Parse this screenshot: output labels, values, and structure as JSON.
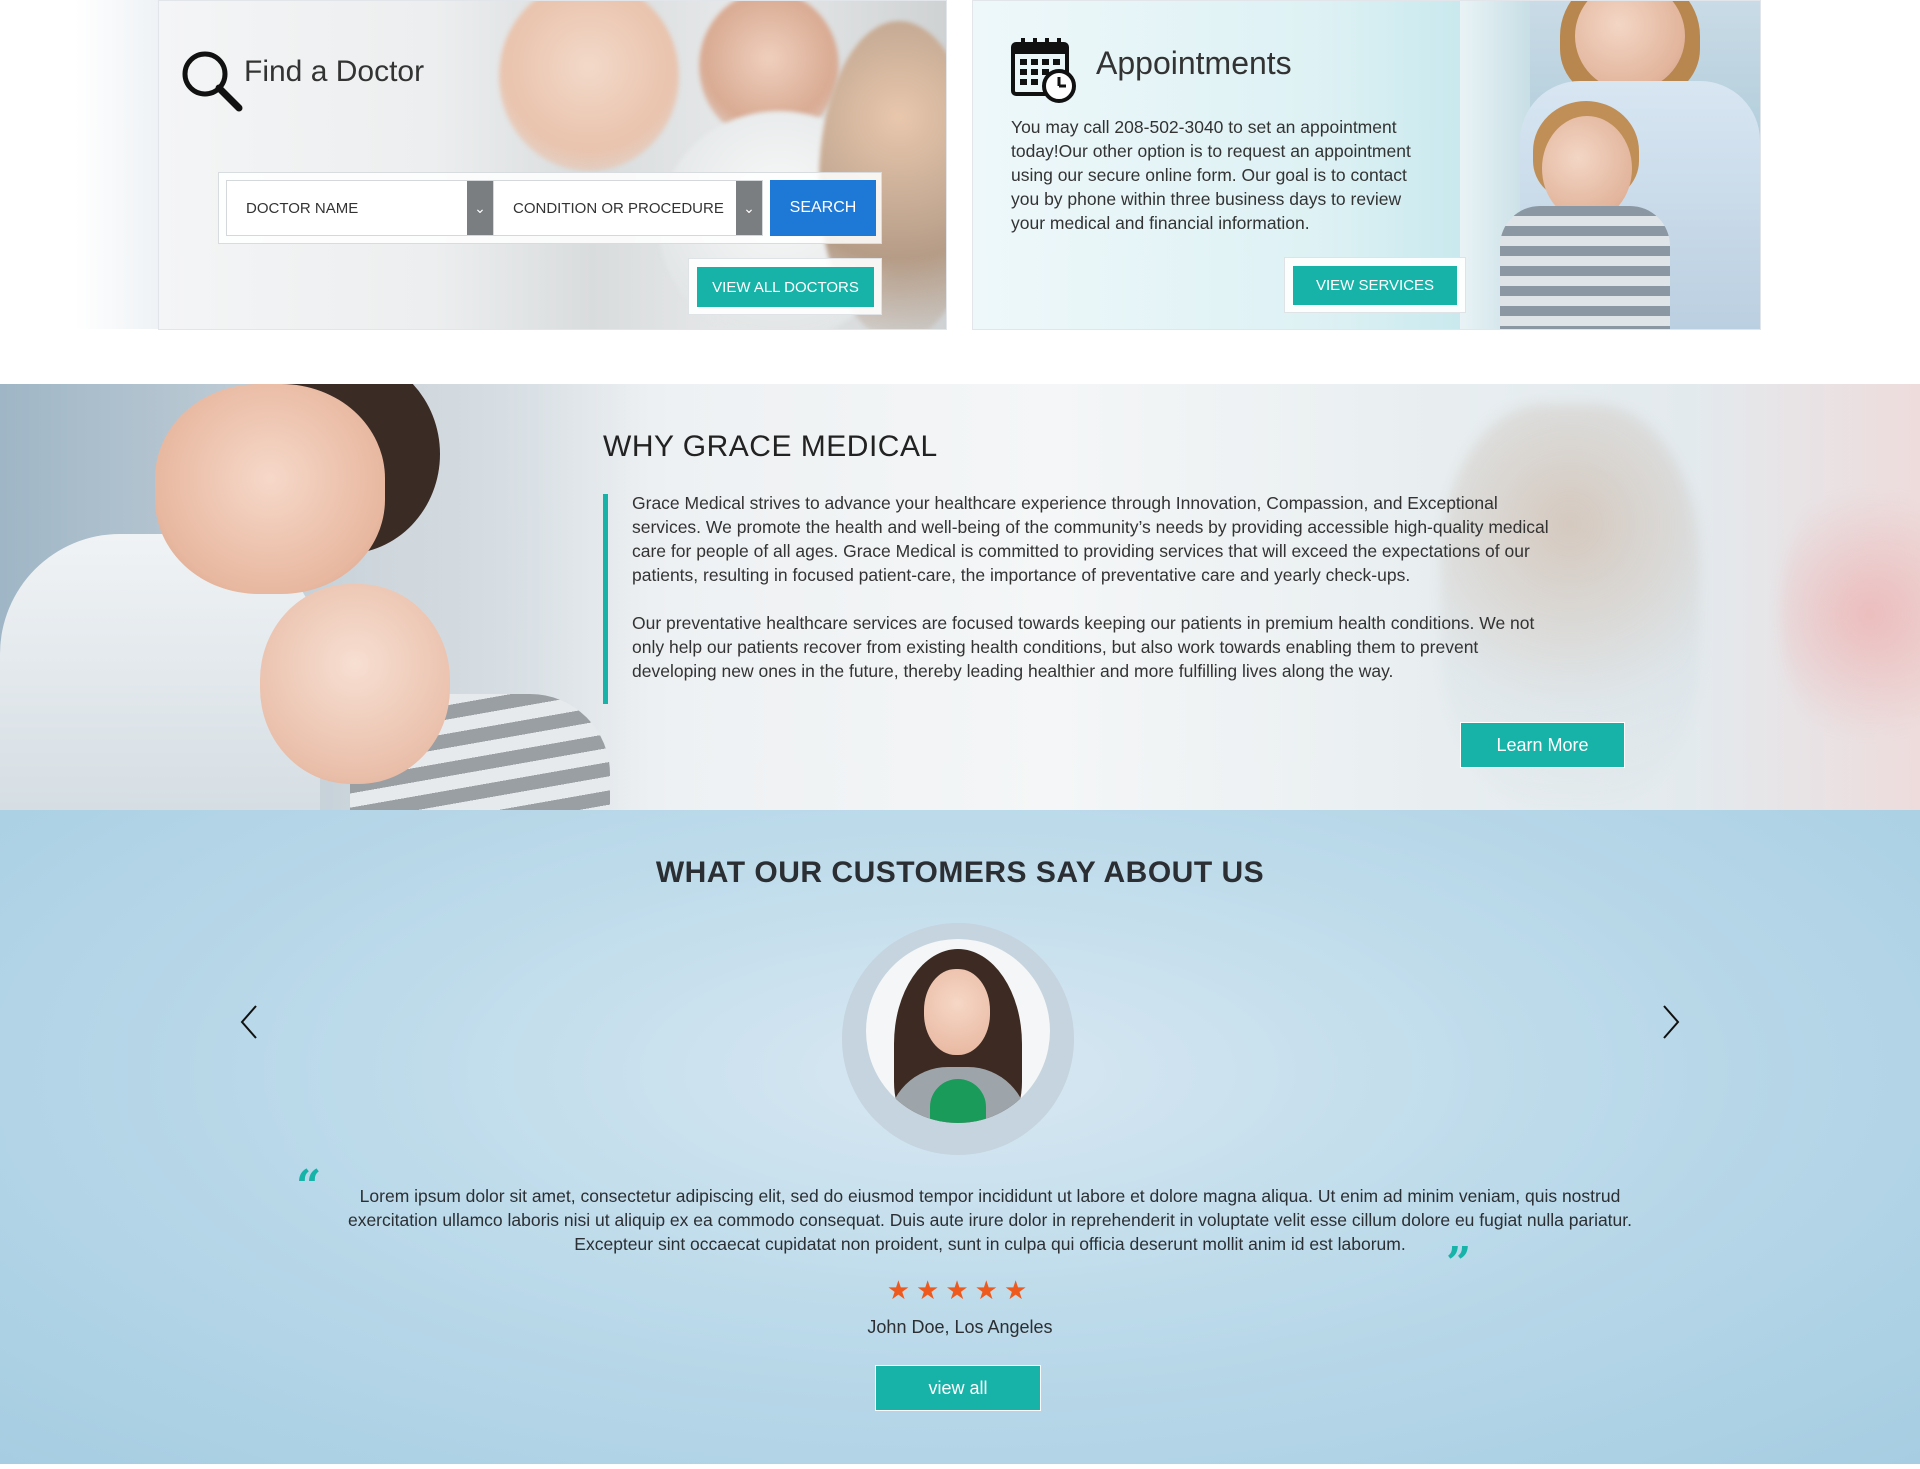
{
  "find_doctor": {
    "title": "Find a Doctor",
    "doctor_select": "DOCTOR NAME",
    "condition_select": "CONDITION OR PROCEDURE",
    "search_label": "SEARCH",
    "view_all_label": "VIEW ALL DOCTORS"
  },
  "appointments": {
    "title": "Appointments",
    "body": "You may call 208-502-3040 to set an appointment today!Our other option is to request an appointment using our secure online form. Our goal is to contact you by phone within three business days to review your medical and financial information.",
    "button_label": "VIEW SERVICES"
  },
  "why": {
    "title": "WHY GRACE MEDICAL",
    "paragraphs": [
      "Grace Medical strives to advance your healthcare experience through Innovation, Compassion, and Exceptional services. We promote the health and well-being of the community’s needs by providing accessible high-quality medical care for people of all ages. Grace Medical is committed to providing services that will exceed the expectations of our patients, resulting in focused patient-care, the importance of preventative care and yearly check-ups.",
      "Our preventative healthcare services are focused towards keeping our patients in premium health conditions. We not only help our patients recover from existing health conditions, but also work towards enabling them to prevent developing new ones in the future, thereby leading healthier and more fulfilling lives along the way."
    ],
    "button_label": "Learn More"
  },
  "testimonials": {
    "title": "WHAT OUR CUSTOMERS SAY ABOUT US",
    "quote": "Lorem ipsum dolor sit amet, consectetur adipiscing elit, sed do eiusmod tempor incididunt ut labore et dolore magna aliqua. Ut enim ad minim veniam, quis nostrud exercitation ullamco laboris nisi ut aliquip ex ea commodo consequat. Duis aute irure dolor in reprehenderit in voluptate velit esse cillum dolore eu fugiat nulla pariatur. Excepteur sint occaecat cupidatat non proident, sunt in culpa qui officia deserunt mollit anim id est laborum.",
    "rating": 5,
    "stars": "★★★★★",
    "author": "John Doe, Los Angeles",
    "button_label": "view all"
  },
  "colors": {
    "teal": "#17b3a9",
    "blue": "#1e78d6",
    "star": "#ee5a1e"
  },
  "icons": [
    "search-icon",
    "calendar-clock-icon",
    "chevron-down-icon",
    "chevron-left-icon",
    "chevron-right-icon",
    "quote-open-icon",
    "quote-close-icon",
    "star-icon"
  ]
}
